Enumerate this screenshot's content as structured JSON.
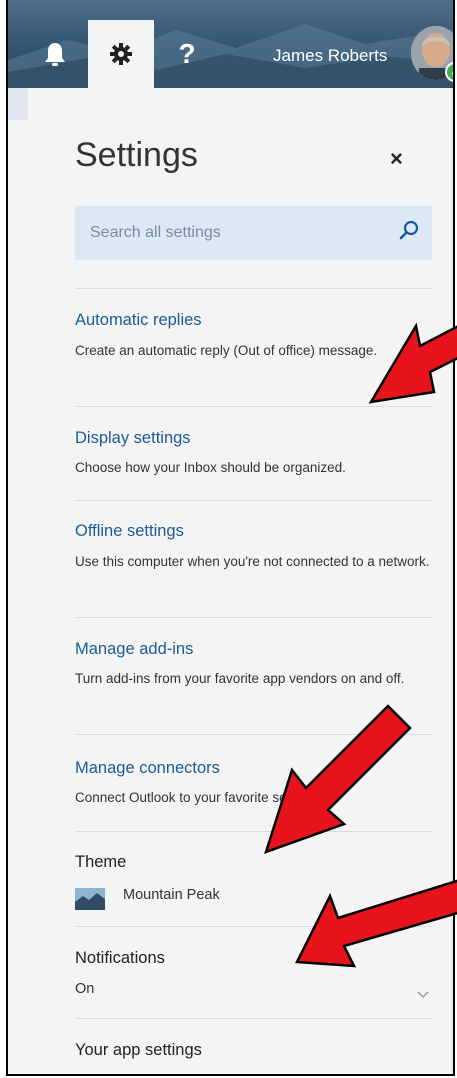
{
  "header": {
    "tabs": [
      {
        "name": "notifications",
        "icon": "bell-icon"
      },
      {
        "name": "settings",
        "icon": "gear-icon",
        "active": true
      },
      {
        "name": "help",
        "glyph": "?"
      }
    ],
    "user_name": "James Roberts",
    "presence": "available"
  },
  "settings": {
    "title": "Settings",
    "close_glyph": "×",
    "search_placeholder": "Search all settings",
    "items": [
      {
        "title": "Automatic replies",
        "desc": "Create an automatic reply (Out of office) message."
      },
      {
        "title": "Display settings",
        "desc": "Choose how your Inbox should be organized."
      },
      {
        "title": "Offline settings",
        "desc": "Use this computer when you're not connected to a network."
      },
      {
        "title": "Manage add-ins",
        "desc": "Turn add-ins from your favorite app vendors on and off."
      },
      {
        "title": "Manage connectors",
        "desc": "Connect Outlook to your favorite services."
      }
    ],
    "theme": {
      "label": "Theme",
      "value": "Mountain Peak"
    },
    "notifications": {
      "label": "Notifications",
      "value": "On"
    },
    "app_settings_label": "Your app settings"
  },
  "colors": {
    "link": "#1a5b99",
    "search_bg": "#dbe9f4",
    "annotation_arrow": "#e8141b"
  }
}
